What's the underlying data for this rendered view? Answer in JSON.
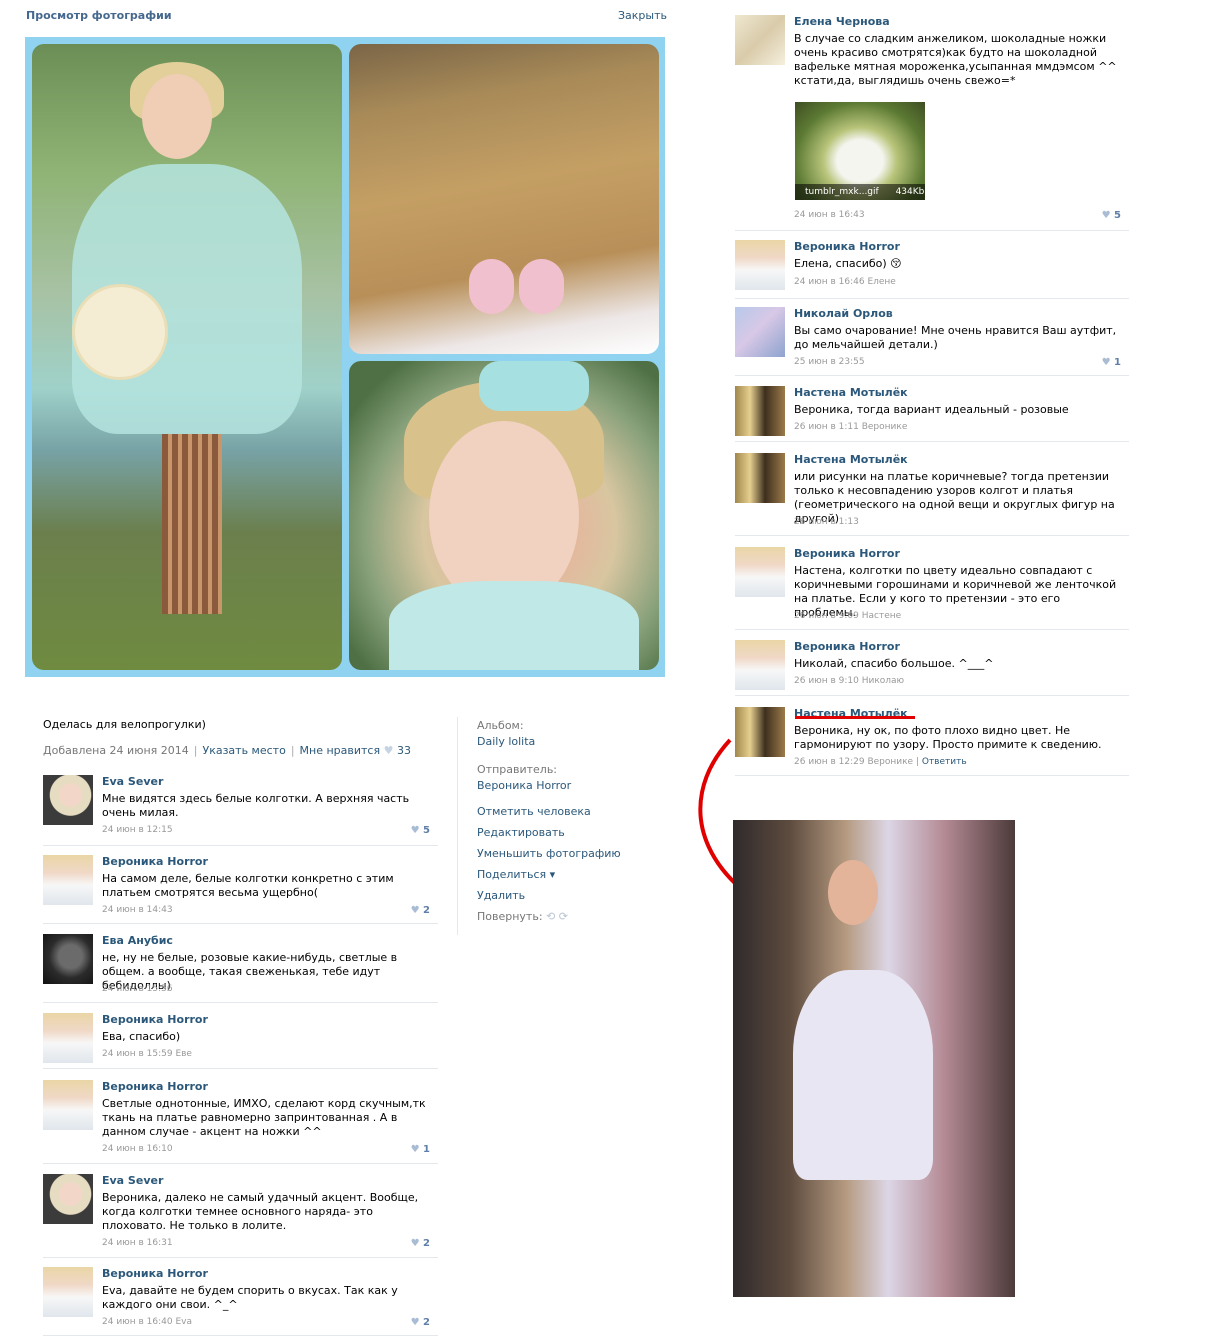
{
  "header": {
    "title": "Просмотр фотографии",
    "close": "Закрыть"
  },
  "photo": {
    "description": "Оделась для велопрогулки)",
    "added": "Добавлена 24 июня 2014",
    "place_link": "Указать место",
    "like_link": "Мне нравится",
    "like_count": "33"
  },
  "side": {
    "album_label": "Альбом:",
    "album_name": "Daily lolita",
    "sender_label": "Отправитель:",
    "sender_name": "Вероника Horror",
    "actions": [
      "Отметить человека",
      "Редактировать",
      "Уменьшить фотографию",
      "Поделиться ▾",
      "Удалить"
    ],
    "rotate_label": "Повернуть:"
  },
  "left_comments": [
    {
      "name": "Eva Sever",
      "text": "Мне видятся здесь белые колготки. А верхняя часть очень милая.",
      "time": "24 июн в 12:15",
      "likes": "5",
      "avatar": "eva"
    },
    {
      "name": "Вероника Horror",
      "text": "На самом деле, белые колготки конкретно с этим платьем смотрятся весьма ущербно(",
      "time": "24 июн в 14:43",
      "likes": "2",
      "avatar": "veronika"
    },
    {
      "name": "Ева Анубис",
      "text": "не, ну не белые, розовые какие-нибудь, светлые в общем. а вообще, такая свеженькая, тебе идут бебидоллы)",
      "time": "24 июн в 15:56",
      "likes": "",
      "avatar": "anubis"
    },
    {
      "name": "Вероника Horror",
      "text": "Ева, спасибо)",
      "time": "24 июн в 15:59 Еве",
      "likes": "",
      "avatar": "veronika"
    },
    {
      "name": "Вероника Horror",
      "text": "Светлые однотонные, ИМХО, сделают корд скучным,тк ткань на платье равномерно запринтованная . А в данном случае - акцент на ножки ^^",
      "time": "24 июн в 16:10",
      "likes": "1",
      "avatar": "veronika"
    },
    {
      "name": "Eva Sever",
      "text": "Вероника, далеко не самый удачный акцент. Вообще, когда колготки темнее основного наряда- это плоховато. Не только в лолите.",
      "time": "24 июн в 16:31",
      "likes": "2",
      "avatar": "eva"
    },
    {
      "name": "Вероника Horror",
      "text": "Eva, давайте не будем спорить о вкусах. Так как у каждого они свои. ^_^",
      "time": "24 июн в 16:40 Eva",
      "likes": "2",
      "avatar": "veronika"
    }
  ],
  "right_comments": [
    {
      "name": "Елена Чернова",
      "text": "В случае со сладким анжеликом, шоколадные ножки очень красиво смотрятся)как будто на шоколадной вафельке мятная мороженка,усыпанная ммдэмсом ^^ кстати,да, выглядишь очень свежо=*",
      "time": "24 июн в 16:43",
      "likes": "5",
      "avatar": "elena"
    },
    {
      "name": "Вероника Horror",
      "text": "Елена, спасибо) 😚",
      "time": "24 июн в 16:46 Елене",
      "likes": "",
      "avatar": "veronika"
    },
    {
      "name": "Николай Орлов",
      "text": "Вы само очарование! Мне очень нравится Ваш аутфит, до мельчайшей детали.)",
      "time": "25 июн в 23:55",
      "likes": "1",
      "avatar": "nikolay"
    },
    {
      "name": "Настена Мотылёк",
      "text": "Вероника, тогда вариант идеальный - розовые",
      "time": "26 июн в 1:11 Веронике",
      "likes": "",
      "avatar": "nastena"
    },
    {
      "name": "Настена Мотылёк",
      "text": "или рисунки на платье коричневые? тогда претензии только к несовпадению узоров колгот и платья (геометрического на одной вещи и округлых фигур на другой)",
      "time": "26 июн в 1:13",
      "likes": "",
      "avatar": "nastena"
    },
    {
      "name": "Вероника Horror",
      "text": "Настена, колготки по цвету идеально совпадают с коричневыми горошинами и коричневой же ленточкой на платье. Если у кого то претензии - это его проблемы.",
      "time": "26 июн в 9:09 Настене",
      "likes": "",
      "avatar": "veronika"
    },
    {
      "name": "Вероника Horror",
      "text": "Николай, спасибо большое. ^___^",
      "time": "26 июн в 9:10 Николаю",
      "likes": "",
      "avatar": "veronika"
    },
    {
      "name": "Настена Мотылёк",
      "text": "Вероника, ну ок, по фото плохо видно цвет. Не гармонируют по узору. Просто примите к сведению.",
      "time": "26 июн в 12:29 Веронике",
      "likes": "",
      "avatar": "nastena",
      "reply": "Ответить"
    }
  ],
  "gif": {
    "caption": "tumblr_mxk...gif",
    "size": "434Kb"
  },
  "colors": {
    "link": "#2b587a",
    "title": "#45688e",
    "collage_bg": "#8fd3f0",
    "annotation_red": "#e00000"
  }
}
